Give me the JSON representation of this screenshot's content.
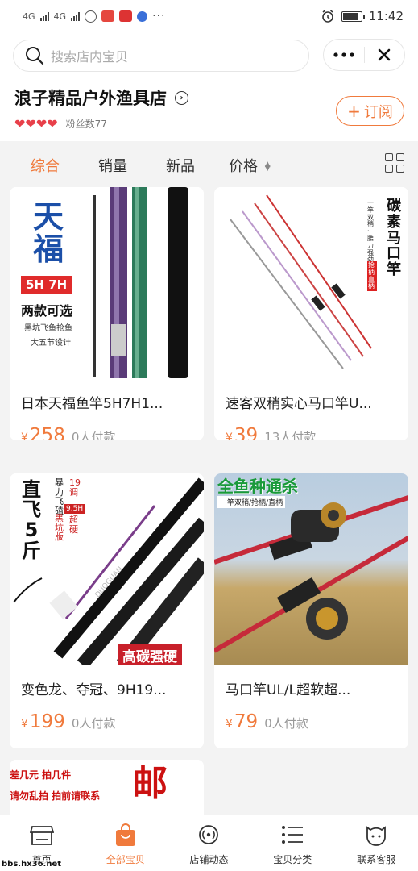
{
  "status_bar": {
    "signal_1": "4G",
    "signal_2": "4G",
    "time": "11:42",
    "battery_level": 0.9
  },
  "header": {
    "search_placeholder": "搜索店内宝贝",
    "more_icon": "more-dots-icon",
    "close_icon": "close-icon",
    "shop_name": "浪子精品户外渔具店",
    "hearts": "❤❤❤❤",
    "fans_label": "粉丝数77",
    "subscribe_label": "订阅"
  },
  "tabs": [
    {
      "label": "综合",
      "active": true
    },
    {
      "label": "销量",
      "active": false
    },
    {
      "label": "新品",
      "active": false
    },
    {
      "label": "价格",
      "active": false
    }
  ],
  "products": [
    {
      "title": "日本天福鱼竿5H7H1...",
      "currency": "¥",
      "price": "258",
      "sold": "0人付款",
      "image_text": {
        "brand": "天福",
        "model": "5H 7H",
        "tag": "两款可选",
        "line1": "黑坑飞鱼抢鱼",
        "line2": "大五节设计"
      }
    },
    {
      "title": "速客双稍实心马口竿U...",
      "currency": "¥",
      "price": "39",
      "sold": "13人付款",
      "image_text": {
        "headline": "碳素马口竿",
        "side": "一竿双稍 · 腰力强劲",
        "badge": "抢柄 直柄"
      }
    },
    {
      "title": "变色龙、夺冠、9H19...",
      "currency": "¥",
      "price": "199",
      "sold": "0人付款",
      "image_text": {
        "big": "直飞5斤",
        "spec1": "暴力飞磕",
        "spec2": "19调",
        "spec3": "9.5H",
        "spec4": "超硬",
        "spec5": "黑坑版",
        "banner": "高碳强硬",
        "brand": "DUOGUAN"
      }
    },
    {
      "title": "马口竿UL/L超软超...",
      "currency": "¥",
      "price": "79",
      "sold": "0人付款",
      "image_text": {
        "headline": "全鱼种通杀",
        "sub": "一竿双稍/抢柄/直柄"
      }
    },
    {
      "title": "",
      "image_text": {
        "line1": "差几元 拍几件",
        "line2": "请勿乱拍 拍前请联系",
        "big": "邮"
      }
    }
  ],
  "bottom_nav": [
    {
      "label": "首页",
      "icon": "shop-icon",
      "active": false
    },
    {
      "label": "全部宝贝",
      "icon": "shopping-bag-icon",
      "active": true
    },
    {
      "label": "店铺动态",
      "icon": "broadcast-icon",
      "active": false
    },
    {
      "label": "宝贝分类",
      "icon": "list-icon",
      "active": false
    },
    {
      "label": "联系客服",
      "icon": "customer-service-icon",
      "active": false
    }
  ],
  "watermark": "bbs.hx36.net",
  "colors": {
    "accent": "#f07a3c",
    "heart": "#e8404a"
  }
}
